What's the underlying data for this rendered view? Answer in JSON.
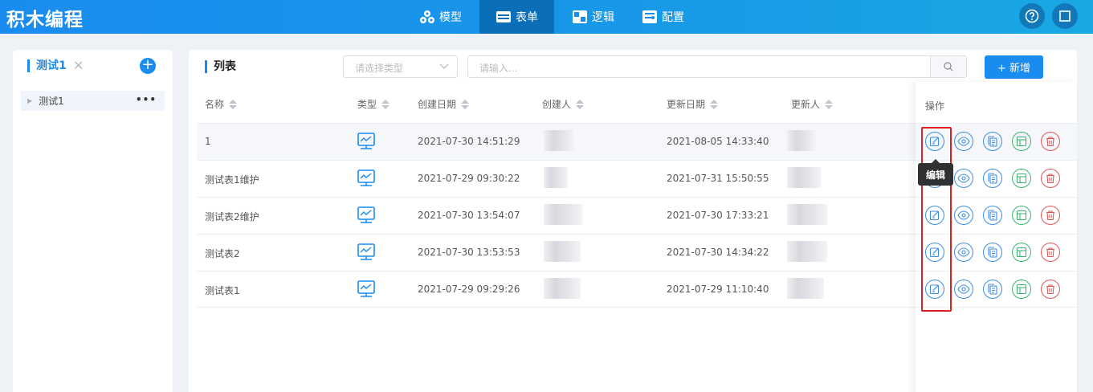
{
  "app": {
    "title": "积木编程"
  },
  "nav": [
    {
      "label": "模型",
      "icon": "cubes-icon",
      "active": false
    },
    {
      "label": "表单",
      "icon": "form-icon",
      "active": true
    },
    {
      "label": "逻辑",
      "icon": "logic-icon",
      "active": false
    },
    {
      "label": "配置",
      "icon": "config-icon",
      "active": false
    }
  ],
  "sidebar": {
    "tab_label": "测试1",
    "close_symbol": "✕",
    "add_symbol": "+",
    "tree": [
      {
        "label": "测试1",
        "more": "•••"
      }
    ]
  },
  "main": {
    "title": "列表",
    "type_select": {
      "placeholder": "请选择类型"
    },
    "search": {
      "placeholder": "请输入..."
    },
    "add_button": "+ 新增",
    "columns": [
      "名称",
      "类型",
      "创建日期",
      "创建人",
      "更新日期",
      "更新人"
    ],
    "operation_header": "操作",
    "rows": [
      {
        "name": "1",
        "created": "2021-07-30 14:51:29",
        "updated": "2021-08-05 14:33:40"
      },
      {
        "name": "测试表1维护",
        "created": "2021-07-29 09:30:22",
        "updated": "2021-07-31 15:50:55"
      },
      {
        "name": "测试表2维护",
        "created": "2021-07-30 13:54:07",
        "updated": "2021-07-30 17:33:21"
      },
      {
        "name": "测试表2",
        "created": "2021-07-30 13:53:53",
        "updated": "2021-07-30 14:34:22"
      },
      {
        "name": "测试表1",
        "created": "2021-07-29 09:29:26",
        "updated": "2021-07-29 11:10:40"
      }
    ],
    "tooltip": "编辑"
  },
  "colors": {
    "primary": "#1a8cf0",
    "danger": "#e25555",
    "success": "#3cb371",
    "highlight_border": "#e02020"
  }
}
